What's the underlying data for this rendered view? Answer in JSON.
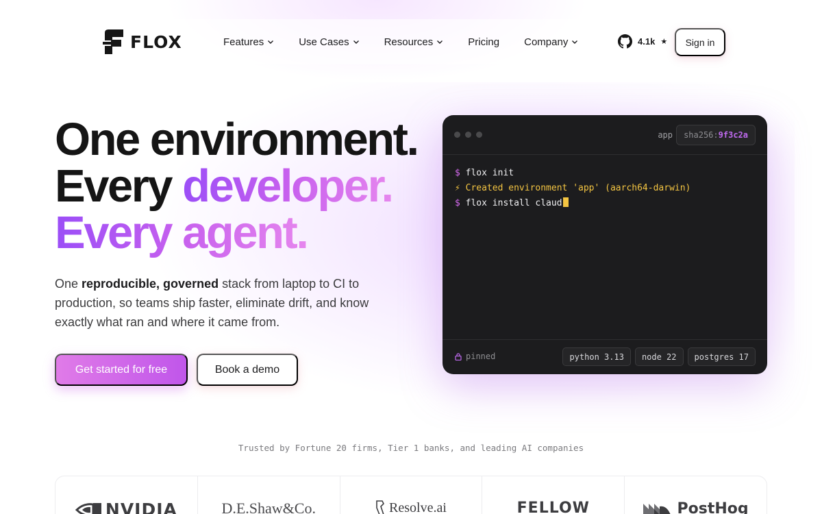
{
  "nav": {
    "brand": "FLOX",
    "menu": [
      {
        "label": "Features",
        "has_dropdown": true
      },
      {
        "label": "Use Cases",
        "has_dropdown": true
      },
      {
        "label": "Resources",
        "has_dropdown": true
      },
      {
        "label": "Pricing",
        "has_dropdown": false
      },
      {
        "label": "Company",
        "has_dropdown": true
      }
    ],
    "github_stars": "4.1k",
    "star_glyph": "★",
    "sign_in": "Sign in"
  },
  "hero": {
    "line1": "One environment.",
    "line2_plain": "Every ",
    "line2_accent": "developer.",
    "line3": "Every agent.",
    "lead_pre": "One ",
    "lead_bold": "reproducible, governed",
    "lead_post": " stack from laptop to CI to production, so teams ship faster, eliminate drift, and know exactly what ran and where it came from.",
    "cta_primary": "Get started for free",
    "cta_secondary": "Book a demo"
  },
  "terminal": {
    "env_name": "app",
    "hash_label": "sha256:",
    "hash_value": "9f3c2a",
    "lines": [
      {
        "kind": "cmd",
        "prefix": "$ ",
        "text": "flox init"
      },
      {
        "kind": "out",
        "prefix": "⚡ ",
        "text": "Created environment 'app' (aarch64-darwin)"
      },
      {
        "kind": "cmd",
        "prefix": "$ ",
        "text": "flox install claud"
      }
    ],
    "pinned_label": "pinned",
    "packages": [
      "python 3.13",
      "node 22",
      "postgres 17"
    ]
  },
  "trust": {
    "tagline": "Trusted by Fortune 20 firms, Tier 1 banks, and leading AI companies",
    "logos": [
      "NVIDIA",
      "D.E.Shaw&Co.",
      "Resolve.ai",
      "FELLOW",
      "PostHog"
    ]
  },
  "colors": {
    "accent_purple": "#9b4ef7",
    "accent_pink": "#e07be8",
    "terminal_bg": "#1c1c1e",
    "terminal_yellow": "#f4c542",
    "terminal_prompt": "#d76bf2"
  }
}
